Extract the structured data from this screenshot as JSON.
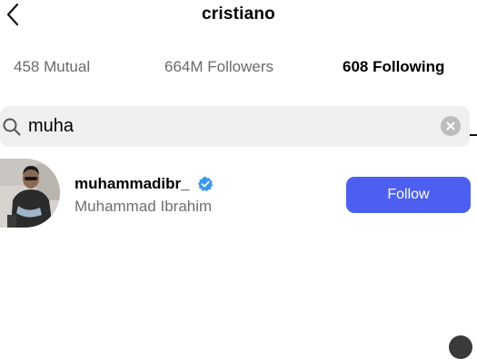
{
  "header": {
    "title": "cristiano",
    "back_icon": "chevron-left-icon"
  },
  "tabs": [
    {
      "label": "458 Mutual",
      "active": false
    },
    {
      "label": "664M Followers",
      "active": false
    },
    {
      "label": "608 Following",
      "active": true
    }
  ],
  "search": {
    "value": "muha",
    "search_icon": "search-icon",
    "clear_icon": "clear-icon"
  },
  "results": [
    {
      "username": "muhammadibr_",
      "full_name": "Muhammad Ibrahim",
      "verified": true,
      "button_label": "Follow"
    }
  ],
  "colors": {
    "accent": "#4c5ff0",
    "verified": "#3897f0",
    "secondary_text": "#6e6e6e",
    "search_bg": "#efefef"
  }
}
